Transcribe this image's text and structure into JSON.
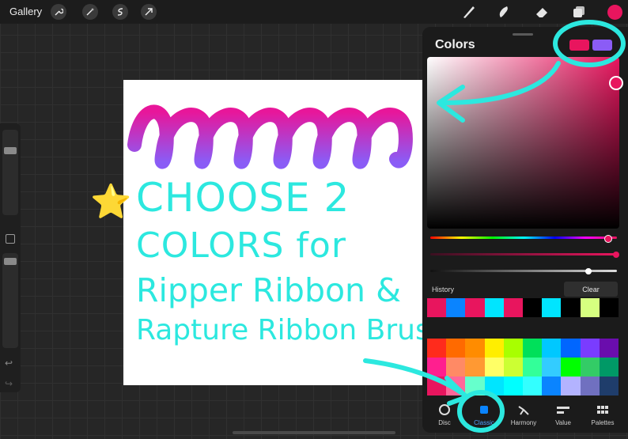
{
  "topbar": {
    "gallery_label": "Gallery",
    "left_tools": [
      "wrench-icon",
      "magic-wand-icon",
      "selection-icon",
      "transform-arrow-icon"
    ],
    "right_tools": [
      "brush-icon",
      "smudge-icon",
      "eraser-icon",
      "layers-icon"
    ],
    "current_color": "#e8155e"
  },
  "sidebar": {
    "size_slider_level": 0.22,
    "opacity_slider_level": 0.05
  },
  "canvas": {
    "annotation_lines": [
      "CHOOSE 2",
      "COLORS for",
      "Ripper Ribbon &",
      "Rapture Ribbon Brushes!"
    ],
    "star_emoji": "⭐"
  },
  "colors_panel": {
    "title": "Colors",
    "primary_color": "#e8155e",
    "secondary_color": "#8b5cf6",
    "history_label": "History",
    "clear_label": "Clear",
    "history": [
      "#e8155e",
      "#0a84ff",
      "#e8155e",
      "#00e5ff",
      "#e8155e",
      "#000000",
      "#00e5ff",
      "#000000",
      "#d6ff80",
      "#000000"
    ],
    "palette": [
      [
        "#ff2b1c",
        "#ff6a00",
        "#ff8c00",
        "#ffee00",
        "#a8ff00",
        "#00e05a",
        "#00c8ff",
        "#0066ff",
        "#7a3cff",
        "#6a0dad"
      ],
      [
        "#ff1f8f",
        "#ff8a65",
        "#ff9933",
        "#ffff66",
        "#ccff33",
        "#33ff99",
        "#33ccff",
        "#00ff00",
        "#33cc66",
        "#009966"
      ],
      [
        "#e8155e",
        "#ff6699",
        "#66ffcc",
        "#00e5ff",
        "#00ffff",
        "#33ffff",
        "#0a84ff",
        "#b3b3ff",
        "#7070c0",
        "#1f3d6b"
      ]
    ],
    "tabs": [
      {
        "label": "Disc",
        "icon": "disc-icon"
      },
      {
        "label": "Classic",
        "icon": "classic-square-icon"
      },
      {
        "label": "Harmony",
        "icon": "harmony-icon"
      },
      {
        "label": "Value",
        "icon": "value-sliders-icon"
      },
      {
        "label": "Palettes",
        "icon": "palettes-grid-icon"
      }
    ],
    "active_tab": "Classic"
  },
  "colors": {
    "annotation": "#2ce8df",
    "accent": "#e8155e",
    "ribbon_start": "#e8169a",
    "ribbon_end": "#8a5cf6"
  }
}
